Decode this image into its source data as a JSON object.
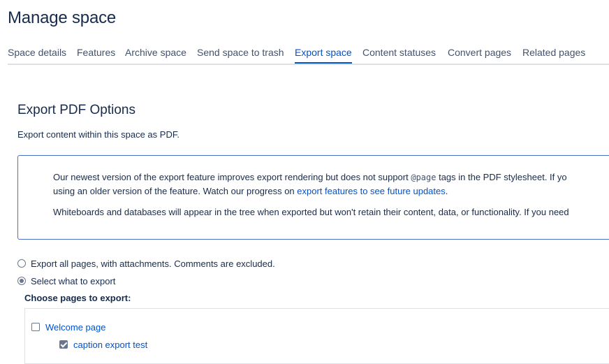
{
  "page": {
    "title": "Manage space"
  },
  "tabs": [
    {
      "label": "Space details"
    },
    {
      "label": "Features"
    },
    {
      "label": "Archive space"
    },
    {
      "label": "Send space to trash"
    },
    {
      "label": "Export space",
      "active": true
    },
    {
      "label": "Content statuses"
    },
    {
      "label": "Convert pages"
    },
    {
      "label": "Related pages"
    }
  ],
  "export": {
    "title": "Export PDF Options",
    "description": "Export content within this space as PDF.",
    "info": {
      "p1_before": "Our newest version of the export feature improves export rendering but does not support ",
      "p1_code": "@page",
      "p1_after": " tags in the PDF stylesheet. If yo",
      "p2_before": "using an older version of the feature. Watch our progress on ",
      "p2_link": "export features to see future updates",
      "p2_after": ".",
      "p3": "Whiteboards and databases will appear in the tree when exported but won't retain their content, data, or functionality. If you need"
    },
    "options": [
      {
        "label": "Export all pages, with attachments. Comments are excluded.",
        "selected": false
      },
      {
        "label": "Select what to export",
        "selected": true
      }
    ],
    "choose_label": "Choose pages to export:",
    "tree": [
      {
        "label": "Welcome page",
        "checked": false
      },
      {
        "label": "caption export test",
        "checked": true
      }
    ]
  },
  "colors": {
    "accent": "#0052cc",
    "border_info": "#4c72c7",
    "text": "#172b4d"
  }
}
